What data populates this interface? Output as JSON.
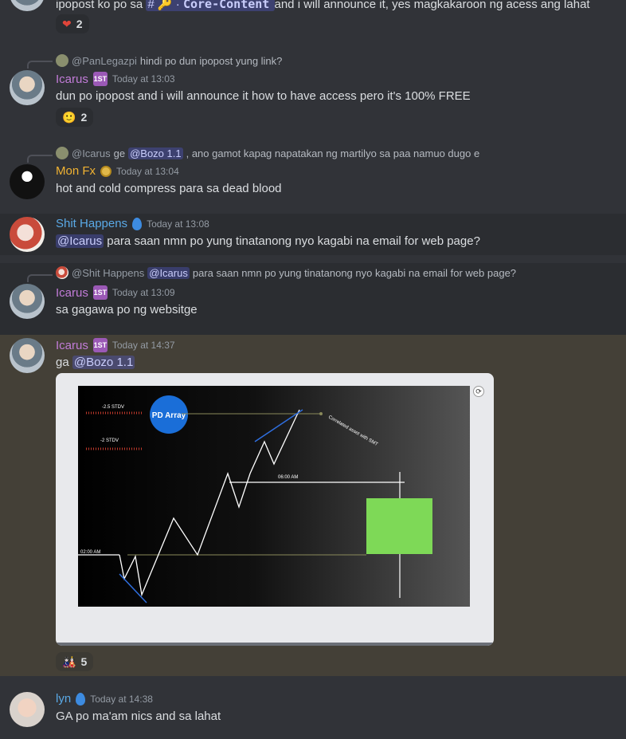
{
  "top_message": {
    "text_before": "ipopost ko po sa",
    "channel_hash": "#",
    "channel_name": "Core-Content",
    "text_after": "and i will announce it, yes magkakaroon ng acess ang lahat",
    "reaction": {
      "emoji": "❤",
      "count": "2"
    }
  },
  "messages": [
    {
      "reply_to": {
        "name": "@PanLegazpi",
        "text": "hindi po dun ipopost yung link?"
      },
      "author": "Icarus",
      "badge": "1ST",
      "time": "Today at 13:03",
      "text": "dun po ipopost and i will announce it how to have access pero it's 100% FREE",
      "reaction": {
        "emoji": "🙂",
        "count": "2"
      }
    },
    {
      "reply_to": {
        "name": "@Icarus",
        "text_before": "ge",
        "mention": "@Bozo 1.1",
        "text_after": ", ano gamot kapag napatakan ng martilyo sa paa namuo dugo e"
      },
      "author": "Mon Fx",
      "time": "Today at 13:04",
      "text": "hot and cold compress para sa dead blood"
    },
    {
      "author": "Shit Happens",
      "time": "Today at 13:08",
      "mention": "@Icarus",
      "text": "para saan nmn po yung tinatanong nyo kagabi na email for web page?"
    },
    {
      "reply_to": {
        "name": "@Shit Happens",
        "mention": "@Icarus",
        "text": "para saan nmn po yung tinatanong nyo kagabi na email for web page?"
      },
      "author": "Icarus",
      "badge": "1ST",
      "time": "Today at 13:09",
      "text": "sa gagawa po ng websitge"
    },
    {
      "author": "Icarus",
      "badge": "1ST",
      "time": "Today at 14:37",
      "text": "ga",
      "mention": "@Bozo 1.1",
      "attachment": {
        "pd_label": "PD Array",
        "stdv1": "-2.5 STDV",
        "stdv2": "-2 STDV",
        "time1": "06:00 AM",
        "time2": "02:00 AM",
        "diag_text": "Correlated asset with SMT"
      },
      "reaction": {
        "emoji": "🎎",
        "count": "5"
      }
    },
    {
      "author": "lyn",
      "time": "Today at 14:38",
      "text": "GA po ma'am nics and sa lahat"
    }
  ]
}
